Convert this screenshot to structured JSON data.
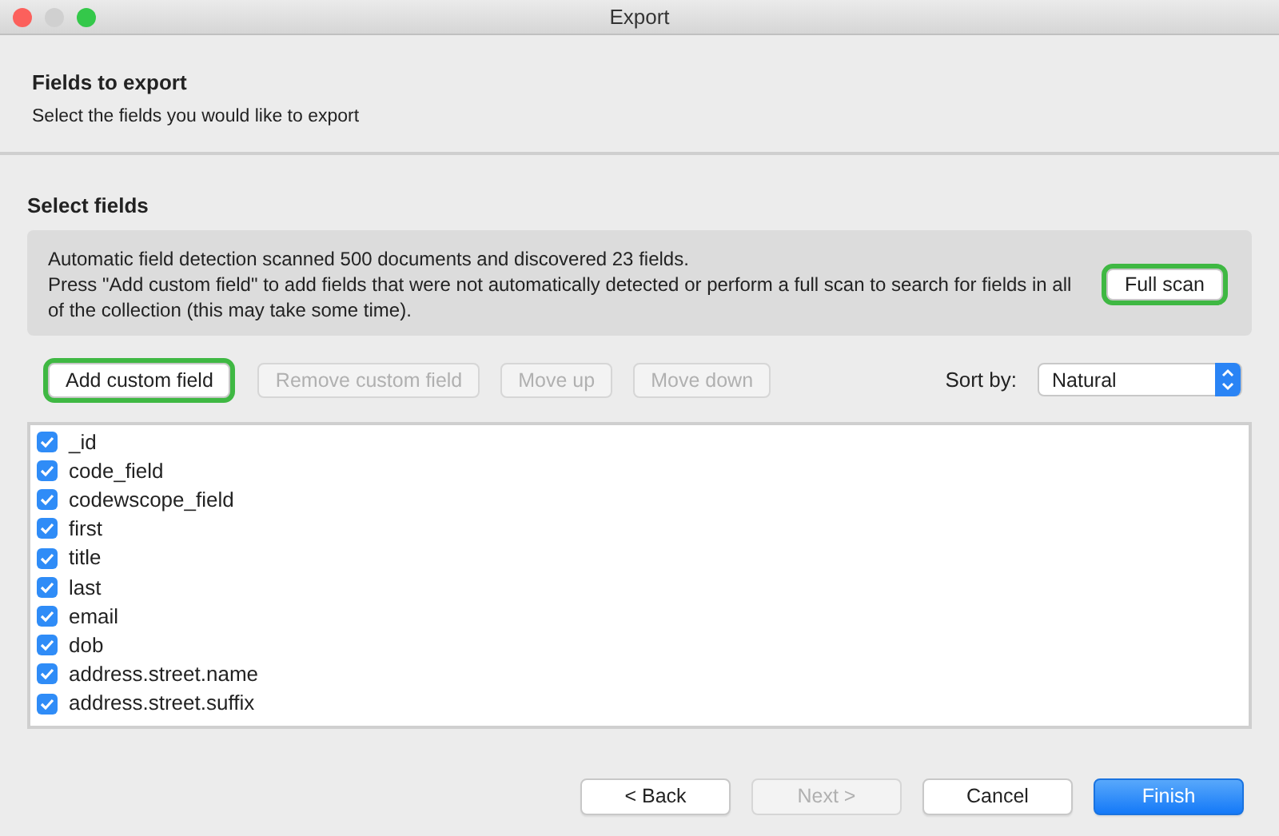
{
  "window": {
    "title": "Export"
  },
  "header": {
    "title": "Fields to export",
    "subtitle": "Select the fields you would like to export"
  },
  "section": {
    "title": "Select fields",
    "info": [
      "Automatic field detection scanned 500 documents and discovered 23 fields.",
      "Press \"Add custom field\" to add fields that were not automatically detected or perform a full scan to search for fields in all of the collection (this may take some time)."
    ],
    "full_scan": {
      "label": "Full scan",
      "highlighted": true
    }
  },
  "toolbar": [
    {
      "label": "Add custom field",
      "disabled": false,
      "highlighted": true
    },
    {
      "label": "Remove custom field",
      "disabled": true,
      "highlighted": false
    },
    {
      "label": "Move up",
      "disabled": true,
      "highlighted": false
    },
    {
      "label": "Move down",
      "disabled": true,
      "highlighted": false
    }
  ],
  "sort": {
    "label": "Sort by:",
    "value": "Natural"
  },
  "fields": [
    {
      "name": "_id",
      "checked": true
    },
    {
      "name": "code_field",
      "checked": true
    },
    {
      "name": "codewscope_field",
      "checked": true
    },
    {
      "name": "first",
      "checked": true
    },
    {
      "name": "title",
      "checked": true
    },
    {
      "name": "last",
      "checked": true
    },
    {
      "name": "email",
      "checked": true
    },
    {
      "name": "dob",
      "checked": true
    },
    {
      "name": "address.street.name",
      "checked": true
    },
    {
      "name": "address.street.suffix",
      "checked": true
    }
  ],
  "footer": [
    {
      "label": "< Back",
      "disabled": false,
      "primary": false
    },
    {
      "label": "Next >",
      "disabled": true,
      "primary": false
    },
    {
      "label": "Cancel",
      "disabled": false,
      "primary": false
    },
    {
      "label": "Finish",
      "disabled": false,
      "primary": true
    }
  ]
}
